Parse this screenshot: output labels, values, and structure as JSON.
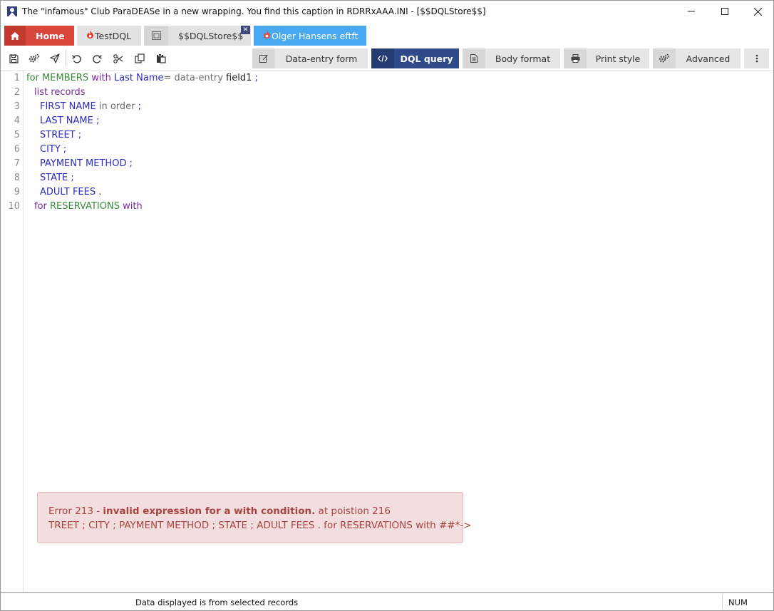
{
  "window": {
    "title": "The \"infamous\" Club ParaDEASe in a new wrapping. You find this caption in RDRRxAAA.INI - [$$DQLStore$$]"
  },
  "tabs": [
    {
      "label": "Home",
      "icon": "home-icon"
    },
    {
      "label": "TestDQL",
      "icon": "flame-icon"
    },
    {
      "label": "$$DQLStore$$",
      "icon": "window-icon"
    },
    {
      "label": "Olger Hansens eftft",
      "icon": "flame-icon"
    }
  ],
  "tab_close_glyph": "✕",
  "view_tabs": [
    {
      "label": "Data-entry form",
      "icon": "edit-icon"
    },
    {
      "label": "DQL query",
      "icon": "code-icon",
      "active": true
    },
    {
      "label": "Body format",
      "icon": "document-icon"
    },
    {
      "label": "Print style",
      "icon": "printer-icon"
    },
    {
      "label": "Advanced",
      "icon": "gears-icon"
    }
  ],
  "code": {
    "line_numbers": [
      "1",
      "2",
      "3",
      "4",
      "5",
      "6",
      "7",
      "8",
      "9",
      "10"
    ],
    "line1": {
      "a": "for ",
      "b": "MEMBERS",
      "c": " with ",
      "d": "Last Name",
      "e": "= data-entry ",
      "f": "field1",
      "g": " ;"
    },
    "line2": {
      "a": "list ",
      "b": "records"
    },
    "line3": {
      "a": "FIRST NAME",
      "b": " in order",
      "c": " ;"
    },
    "line4": {
      "a": "LAST NAME",
      "b": " ;"
    },
    "line5": {
      "a": "STREET",
      "b": " ;"
    },
    "line6": {
      "a": "CITY",
      "b": " ;"
    },
    "line7": {
      "a": "PAYMENT METHOD",
      "b": " ;"
    },
    "line8": {
      "a": "STATE",
      "b": " ;"
    },
    "line9": {
      "a": "ADULT FEES",
      "b": " ."
    },
    "line10": {
      "a": "for ",
      "b": "RESERVATIONS",
      "c": " with"
    }
  },
  "error": {
    "prefix": "Error 213 - ",
    "message": "invalid expression for a with condition.",
    "suffix": " at poistion 216",
    "context": "TREET ; CITY ; PAYMENT METHOD ; STATE ; ADULT FEES . for RESERVATIONS with ##*->"
  },
  "status": {
    "text": "Data displayed is from selected records",
    "num": "NUM"
  },
  "colors": {
    "home_tab": "#d9473a",
    "active_view_tab": "#2f4a88",
    "olger_tab": "#49a9f0",
    "error_bg": "#f2dede",
    "error_text": "#a94442"
  }
}
